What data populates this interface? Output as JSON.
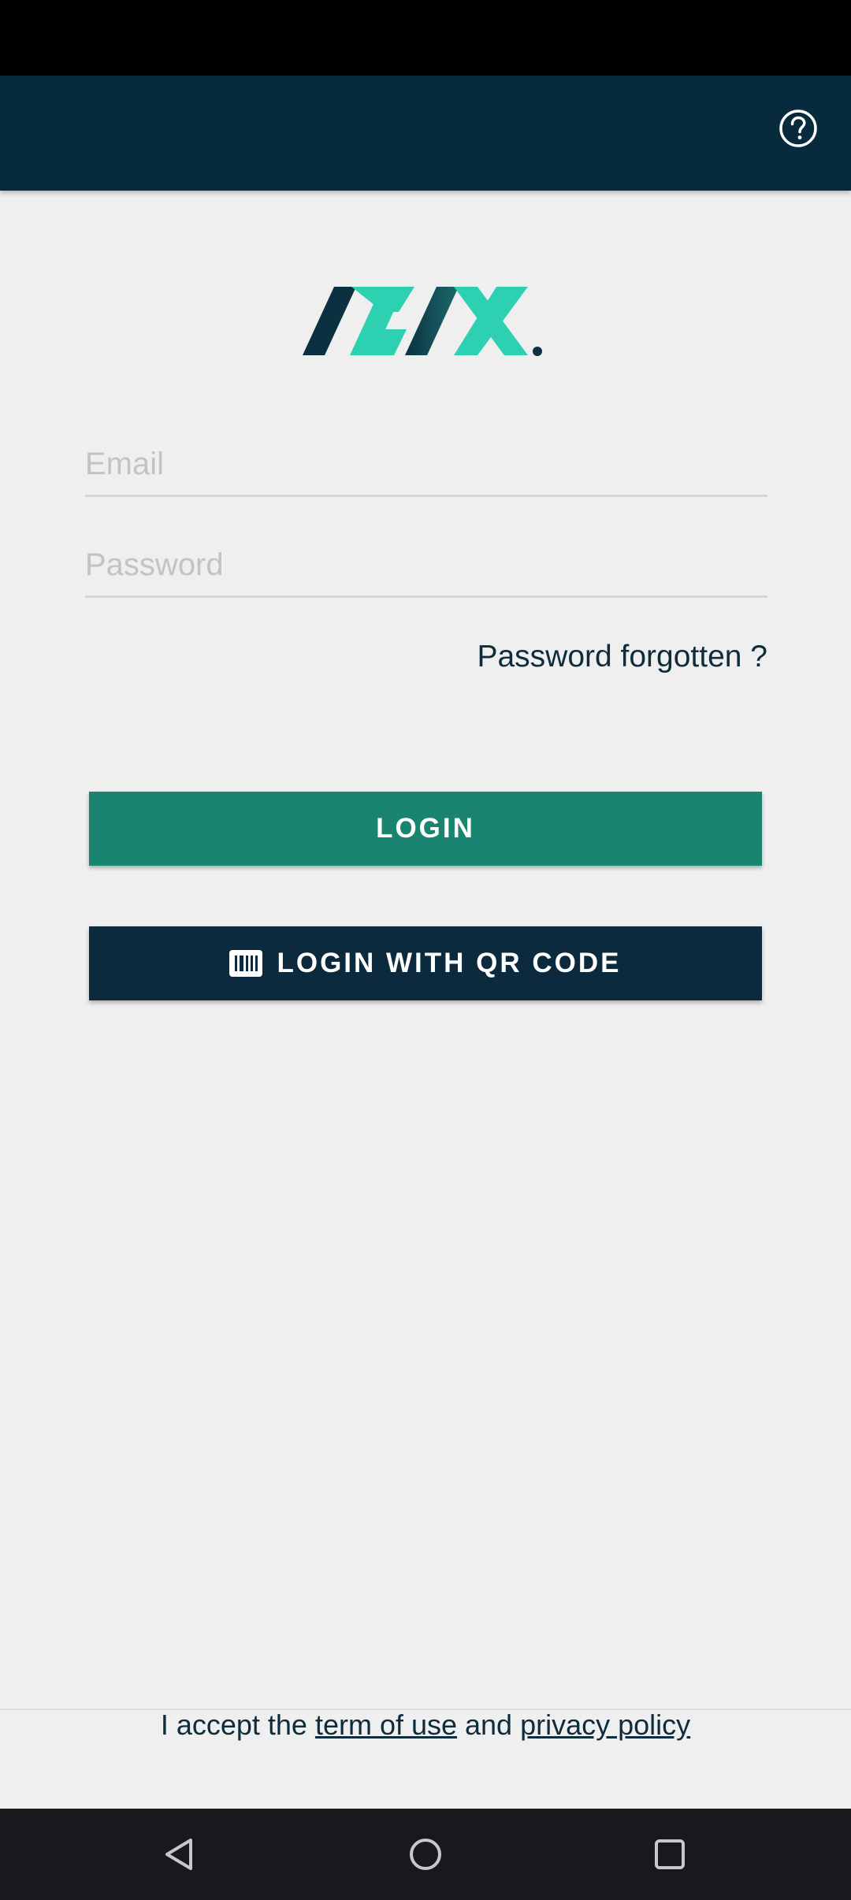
{
  "login": {
    "email_placeholder": "Email",
    "password_placeholder": "Password",
    "forgot_password": "Password forgotten ?",
    "login_button": "LOGIN",
    "qr_button": "LOGIN WITH QR CODE"
  },
  "footer": {
    "prefix": "I accept the ",
    "terms_link": "term of use",
    "middle": " and ",
    "privacy_link": "privacy policy"
  },
  "icons": {
    "help": "help-circle-icon",
    "qr": "barcode-icon",
    "back": "back-triangle-icon",
    "home": "home-circle-icon",
    "recents": "recents-square-icon"
  },
  "colors": {
    "app_bar": "#072a3c",
    "login_button": "#198570",
    "qr_button": "#0b2a3d",
    "logo_teal": "#2dd1b1",
    "logo_dark": "#0b3141",
    "background": "#f0eff0"
  }
}
